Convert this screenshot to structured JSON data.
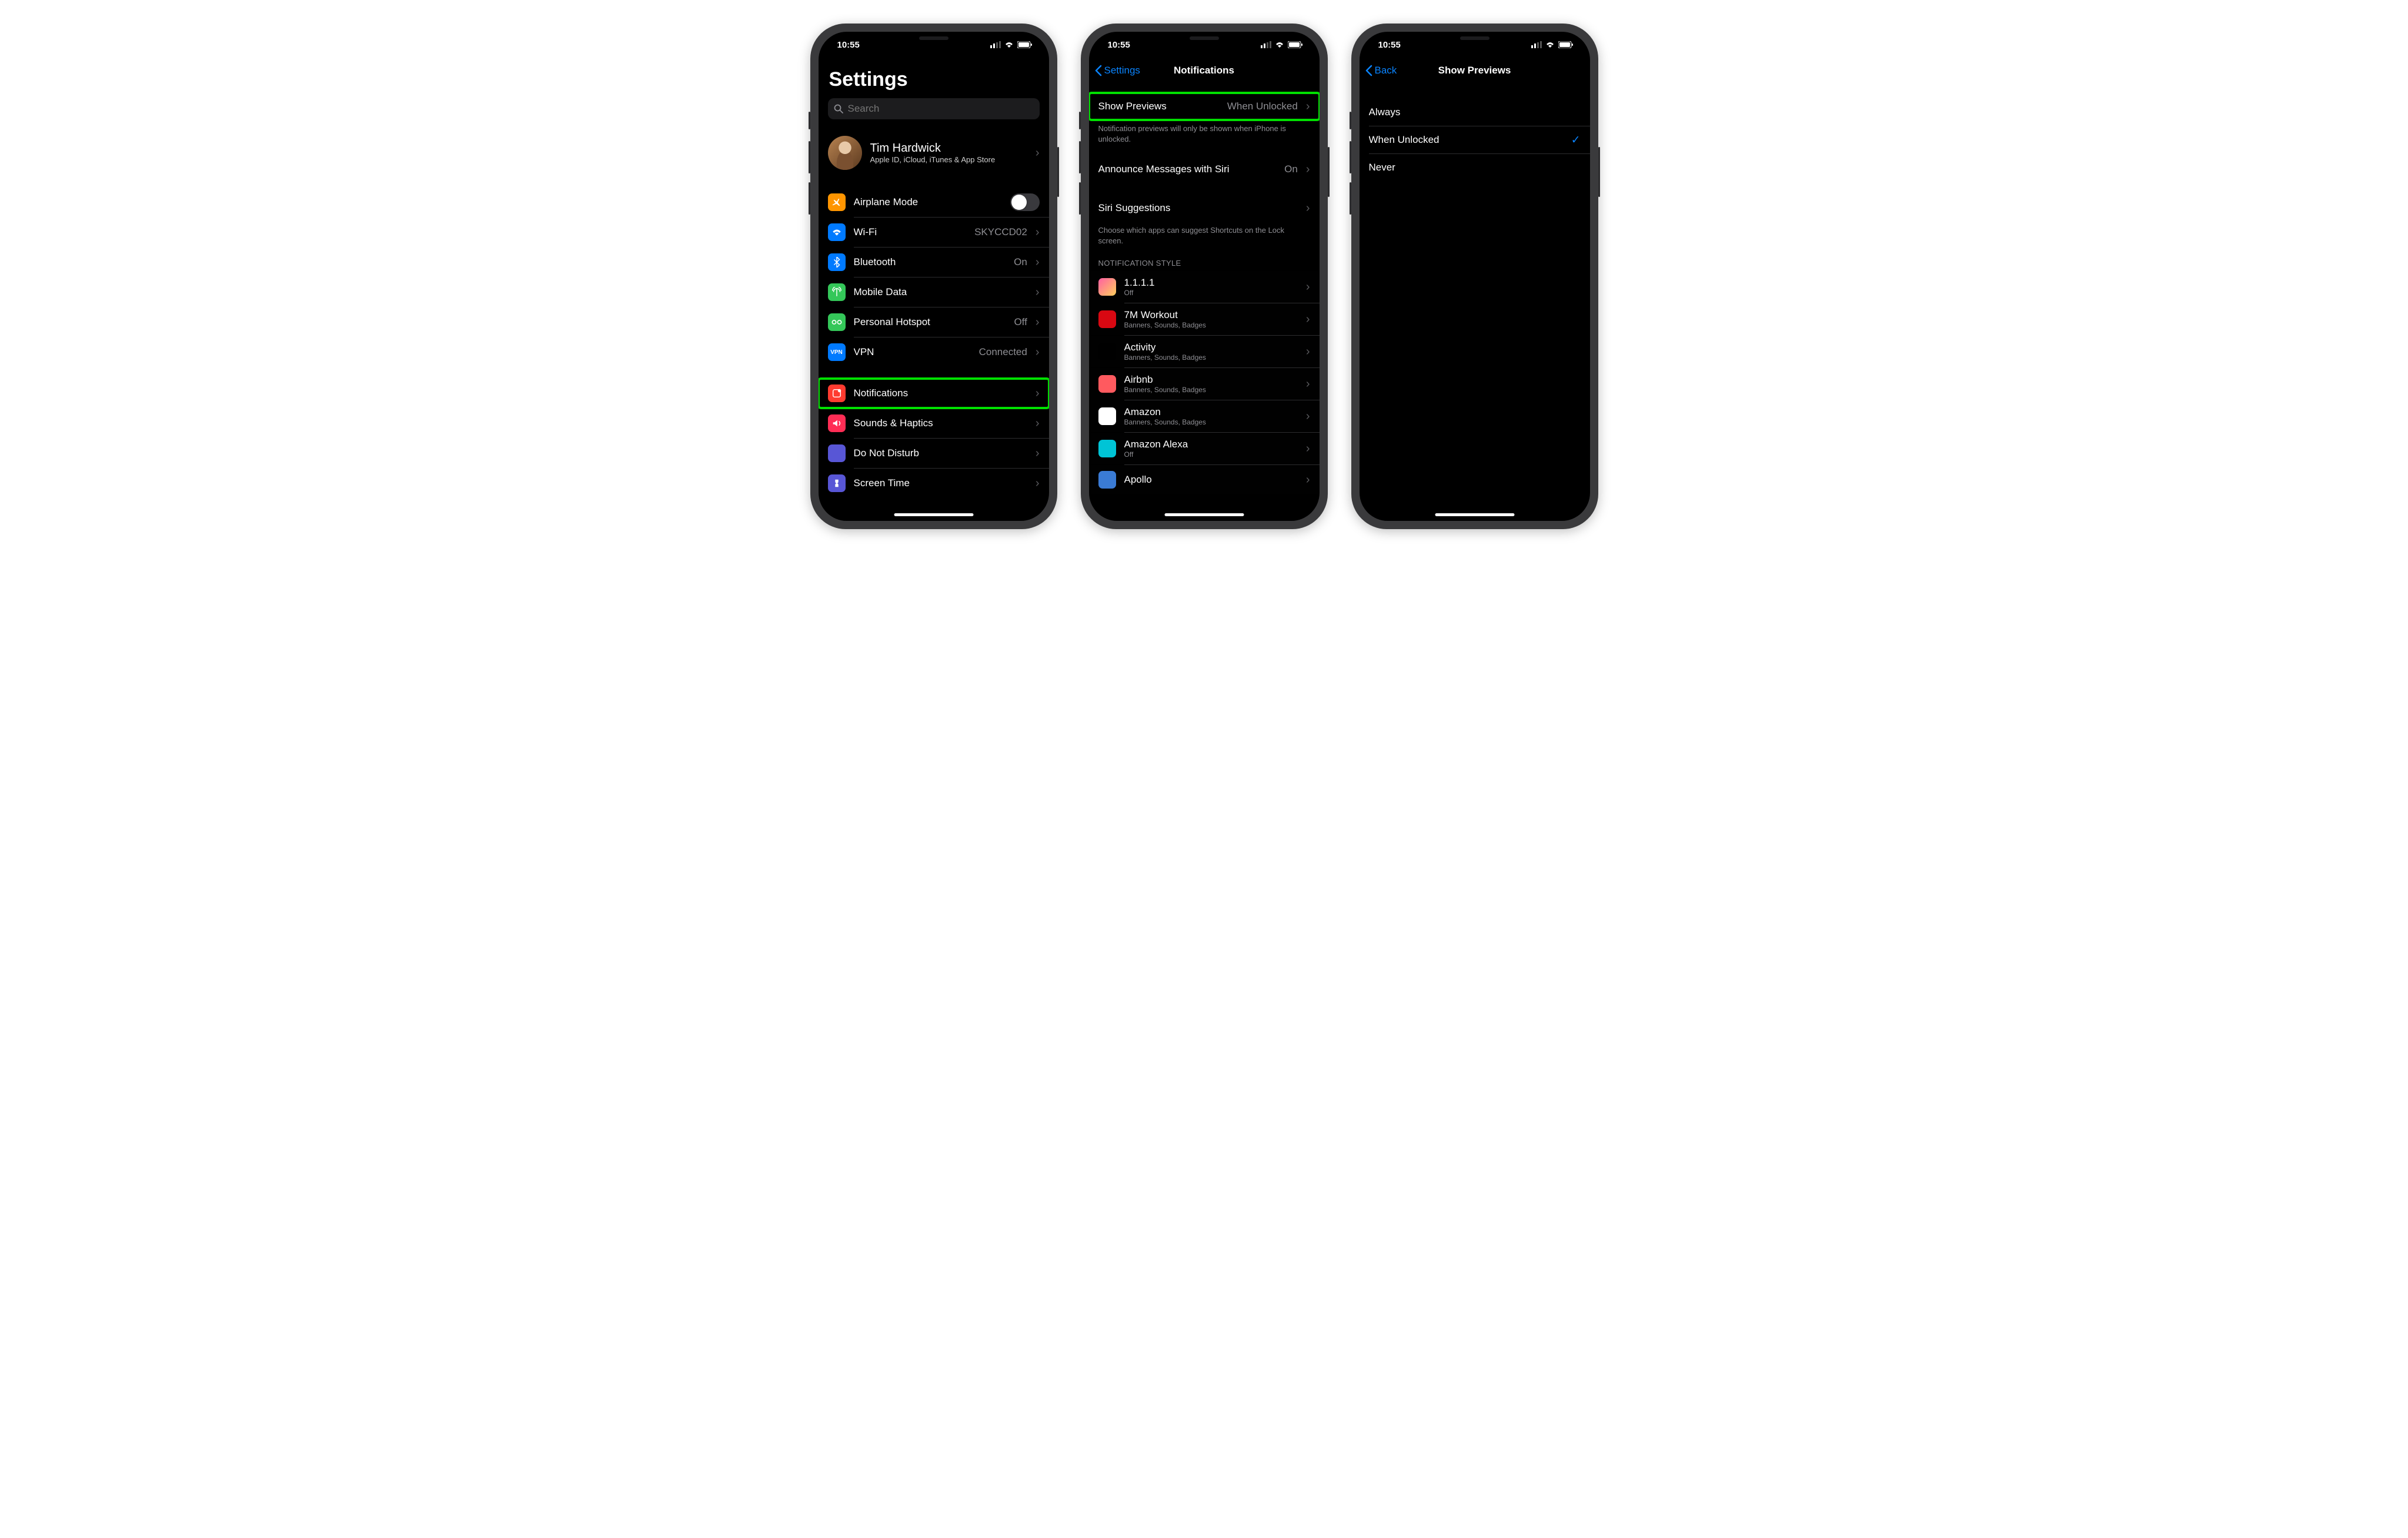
{
  "status": {
    "time": "10:55"
  },
  "screen1": {
    "title": "Settings",
    "searchPlaceholder": "Search",
    "profile": {
      "name": "Tim Hardwick",
      "sub": "Apple ID, iCloud, iTunes & App Store"
    },
    "rows": {
      "airplane": "Airplane Mode",
      "wifi": {
        "label": "Wi-Fi",
        "value": "SKYCCD02"
      },
      "bluetooth": {
        "label": "Bluetooth",
        "value": "On"
      },
      "mobile": "Mobile Data",
      "hotspot": {
        "label": "Personal Hotspot",
        "value": "Off"
      },
      "vpn": {
        "label": "VPN",
        "value": "Connected"
      },
      "notifications": "Notifications",
      "sounds": "Sounds & Haptics",
      "dnd": "Do Not Disturb",
      "screentime": "Screen Time"
    }
  },
  "screen2": {
    "back": "Settings",
    "title": "Notifications",
    "showPreviews": {
      "label": "Show Previews",
      "value": "When Unlocked"
    },
    "previewsFooter": "Notification previews will only be shown when iPhone is unlocked.",
    "announce": {
      "label": "Announce Messages with Siri",
      "value": "On"
    },
    "siri": "Siri Suggestions",
    "siriFooter": "Choose which apps can suggest Shortcuts on the Lock screen.",
    "styleHeader": "Notification Style",
    "apps": [
      {
        "name": "1.1.1.1",
        "sub": "Off",
        "bg": "linear-gradient(135deg,#ff5fa2,#ffcf5c)"
      },
      {
        "name": "7M Workout",
        "sub": "Banners, Sounds, Badges",
        "bg": "#d80812"
      },
      {
        "name": "Activity",
        "sub": "Banners, Sounds, Badges",
        "bg": "#000"
      },
      {
        "name": "Airbnb",
        "sub": "Banners, Sounds, Badges",
        "bg": "#ff5a5f"
      },
      {
        "name": "Amazon",
        "sub": "Banners, Sounds, Badges",
        "bg": "#fff"
      },
      {
        "name": "Amazon Alexa",
        "sub": "Off",
        "bg": "#00c4d6"
      },
      {
        "name": "Apollo",
        "sub": "",
        "bg": "#3a7bd5"
      }
    ]
  },
  "screen3": {
    "back": "Back",
    "title": "Show Previews",
    "options": [
      {
        "label": "Always",
        "checked": false
      },
      {
        "label": "When Unlocked",
        "checked": true
      },
      {
        "label": "Never",
        "checked": false
      }
    ]
  },
  "colors": {
    "accent": "#0a84ff",
    "highlight": "#00e000",
    "orange": "#ff9500",
    "blue": "#007aff",
    "green": "#34c759",
    "red": "#ff3b30",
    "pink": "#ff2d55",
    "indigo": "#5856d6"
  }
}
